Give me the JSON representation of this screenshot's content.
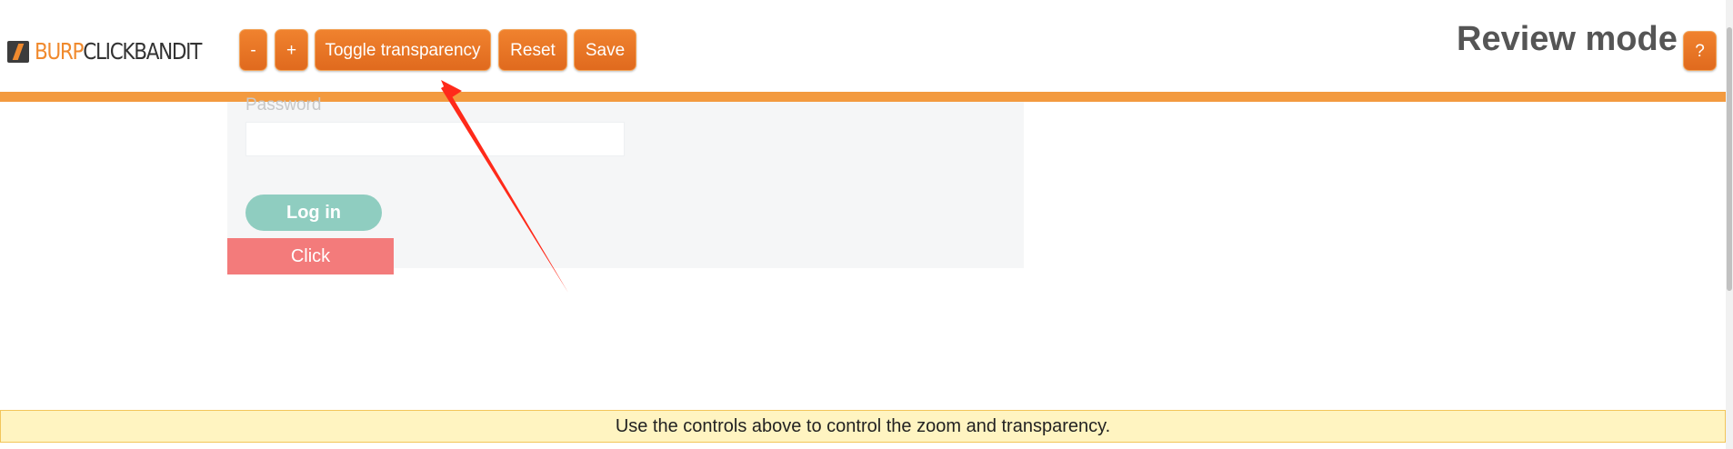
{
  "app": {
    "logo_burp": "BURP",
    "logo_rest": "CLICKBANDIT",
    "mode_title": "Review mode"
  },
  "toolbar": {
    "zoom_out_label": "-",
    "zoom_in_label": "+",
    "toggle_label": "Toggle transparency",
    "reset_label": "Reset",
    "save_label": "Save",
    "help_label": "?"
  },
  "page": {
    "password_label": "Password",
    "login_label": "Log in",
    "click_label": "Click"
  },
  "notice": {
    "text": "Use the controls above to control the zoom and transparency."
  },
  "colors": {
    "accent": "#f08a2e",
    "orange_bar": "#f39a3f",
    "login_button": "#8fcdc0",
    "click_target": "#f37b7b",
    "notice_bg": "#fff4c1",
    "arrow": "#ff2a1a"
  }
}
